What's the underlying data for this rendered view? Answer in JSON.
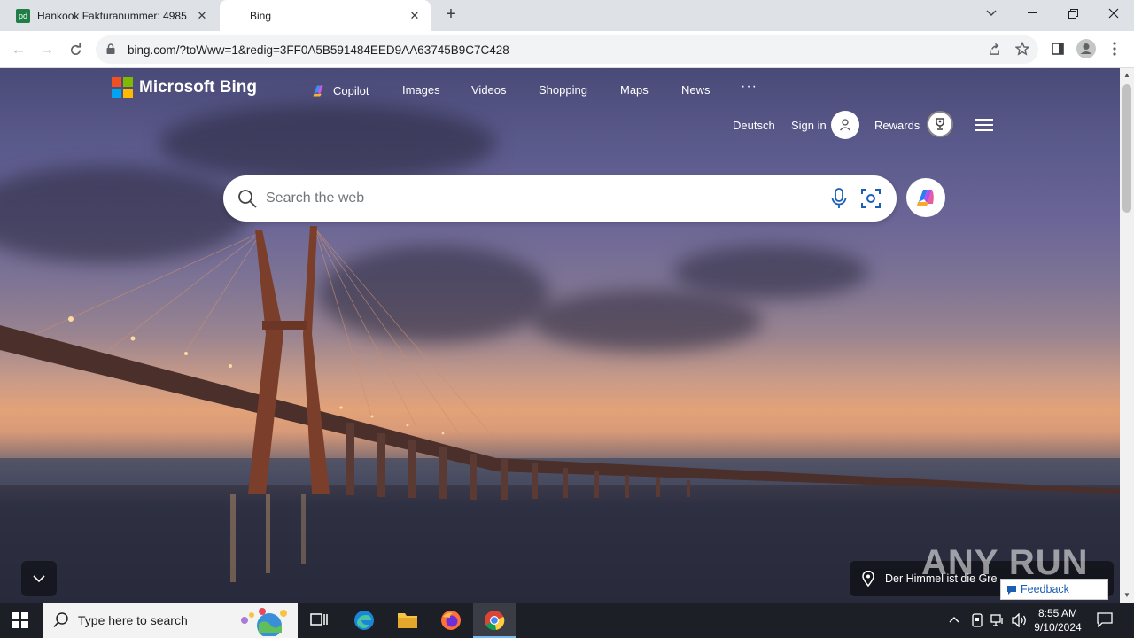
{
  "browser": {
    "tabs": [
      {
        "title": "Hankook Fakturanummer: 4985",
        "favicon_color": "#1e7e45"
      },
      {
        "title": "Bing",
        "favicon_color": "#ffffff"
      }
    ],
    "url": "bing.com/?toWww=1&redig=3FF0A5B591484EED9AA63745B9C7C428"
  },
  "bing": {
    "brand": "Microsoft Bing",
    "nav": [
      "Copilot",
      "Images",
      "Videos",
      "Shopping",
      "Maps",
      "News",
      "···"
    ],
    "language": "Deutsch",
    "sign_in": "Sign in",
    "rewards": "Rewards",
    "search_placeholder": "Search the web",
    "location_caption": "Der Himmel ist die Gre",
    "feedback": "Feedback",
    "watermark": "ANY RUN"
  },
  "taskbar": {
    "search_placeholder": "Type here to search",
    "time": "8:55 AM",
    "date": "9/10/2024"
  }
}
